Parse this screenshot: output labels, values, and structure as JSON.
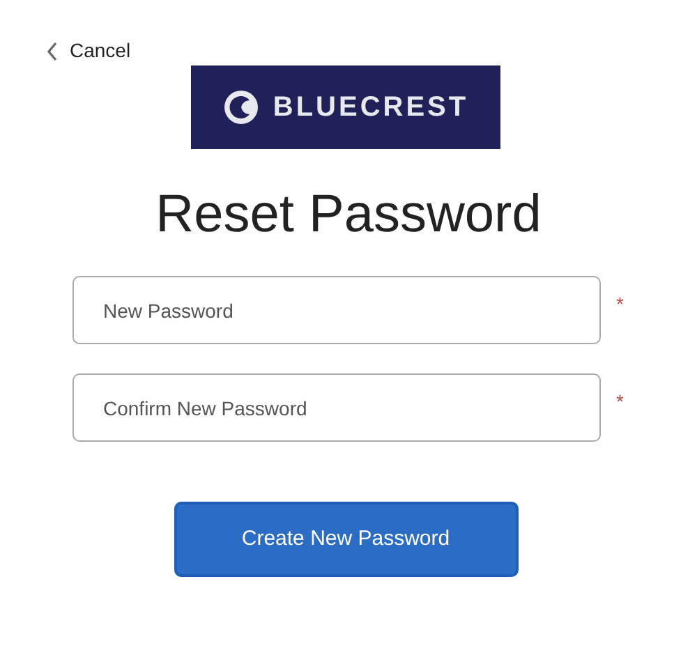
{
  "back_link": {
    "label": "Cancel"
  },
  "logo": {
    "text": "BLUECREST"
  },
  "title": "Reset Password",
  "fields": [
    {
      "placeholder": "New Password",
      "required_mark": "*"
    },
    {
      "placeholder": "Confirm New Password",
      "required_mark": "*"
    }
  ],
  "submit_button": {
    "label": "Create New Password"
  }
}
